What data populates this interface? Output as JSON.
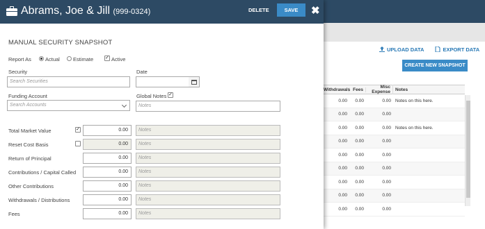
{
  "bg": {
    "upload": "UPLOAD DATA",
    "export": "EXPORT DATA",
    "create": "CREATE NEW SNAPSHOT",
    "columns": [
      "Withdrawals",
      "Fees",
      "Misc Expense",
      "Notes"
    ],
    "rows": [
      [
        "0.00",
        "0.00",
        "0.00",
        "Notes on this here."
      ],
      [
        "0.00",
        "0.00",
        "0.00",
        ""
      ],
      [
        "0.00",
        "0.00",
        "0.00",
        "Notes on this here."
      ],
      [
        "0.00",
        "0.00",
        "0.00",
        ""
      ],
      [
        "0.00",
        "0.00",
        "0.00",
        ""
      ],
      [
        "0.00",
        "0.00",
        "0.00",
        ""
      ],
      [
        "0.00",
        "0.00",
        "0.00",
        ""
      ],
      [
        "0.00",
        "0.00",
        "0.00",
        ""
      ],
      [
        "0.00",
        "0.00",
        "0.00",
        ""
      ]
    ]
  },
  "dialog": {
    "title": "Abrams, Joe & Jill",
    "account": "(999-0324)",
    "delete": "DELETE",
    "save": "SAVE",
    "close": "✖",
    "section": "MANUAL SECURITY SNAPSHOT",
    "report_as": {
      "label": "Report As",
      "actual": "Actual",
      "estimate": "Estimate",
      "active": "Active"
    },
    "security": {
      "label": "Security",
      "placeholder": "Search Securities"
    },
    "date": {
      "label": "Date"
    },
    "funding": {
      "label": "Funding Account",
      "placeholder": "Search Accounts"
    },
    "global_notes": {
      "label": "Global Notes",
      "placeholder": "Notes"
    },
    "fields": [
      {
        "label": "Total Market Value",
        "checkbox": true,
        "checked": true,
        "value": "0.00",
        "gray": false,
        "notes": "Notes"
      },
      {
        "label": "Reset Cost Basis",
        "checkbox": true,
        "checked": false,
        "value": "0.00",
        "gray": true,
        "notes": "Notes"
      },
      {
        "label": "Return of Principal",
        "checkbox": false,
        "value": "0.00",
        "gray": false,
        "notes": "Notes"
      },
      {
        "label": "Contributions / Capital Called",
        "checkbox": false,
        "value": "0.00",
        "gray": false,
        "notes": "Notes"
      },
      {
        "label": "Other Contributions",
        "checkbox": false,
        "value": "0.00",
        "gray": false,
        "notes": "Notes"
      },
      {
        "label": "Withdrawals / Distributions",
        "checkbox": false,
        "value": "0.00",
        "gray": false,
        "notes": "Notes"
      },
      {
        "label": "Fees",
        "checkbox": false,
        "value": "0.00",
        "gray": false,
        "notes": "Notes"
      }
    ]
  }
}
